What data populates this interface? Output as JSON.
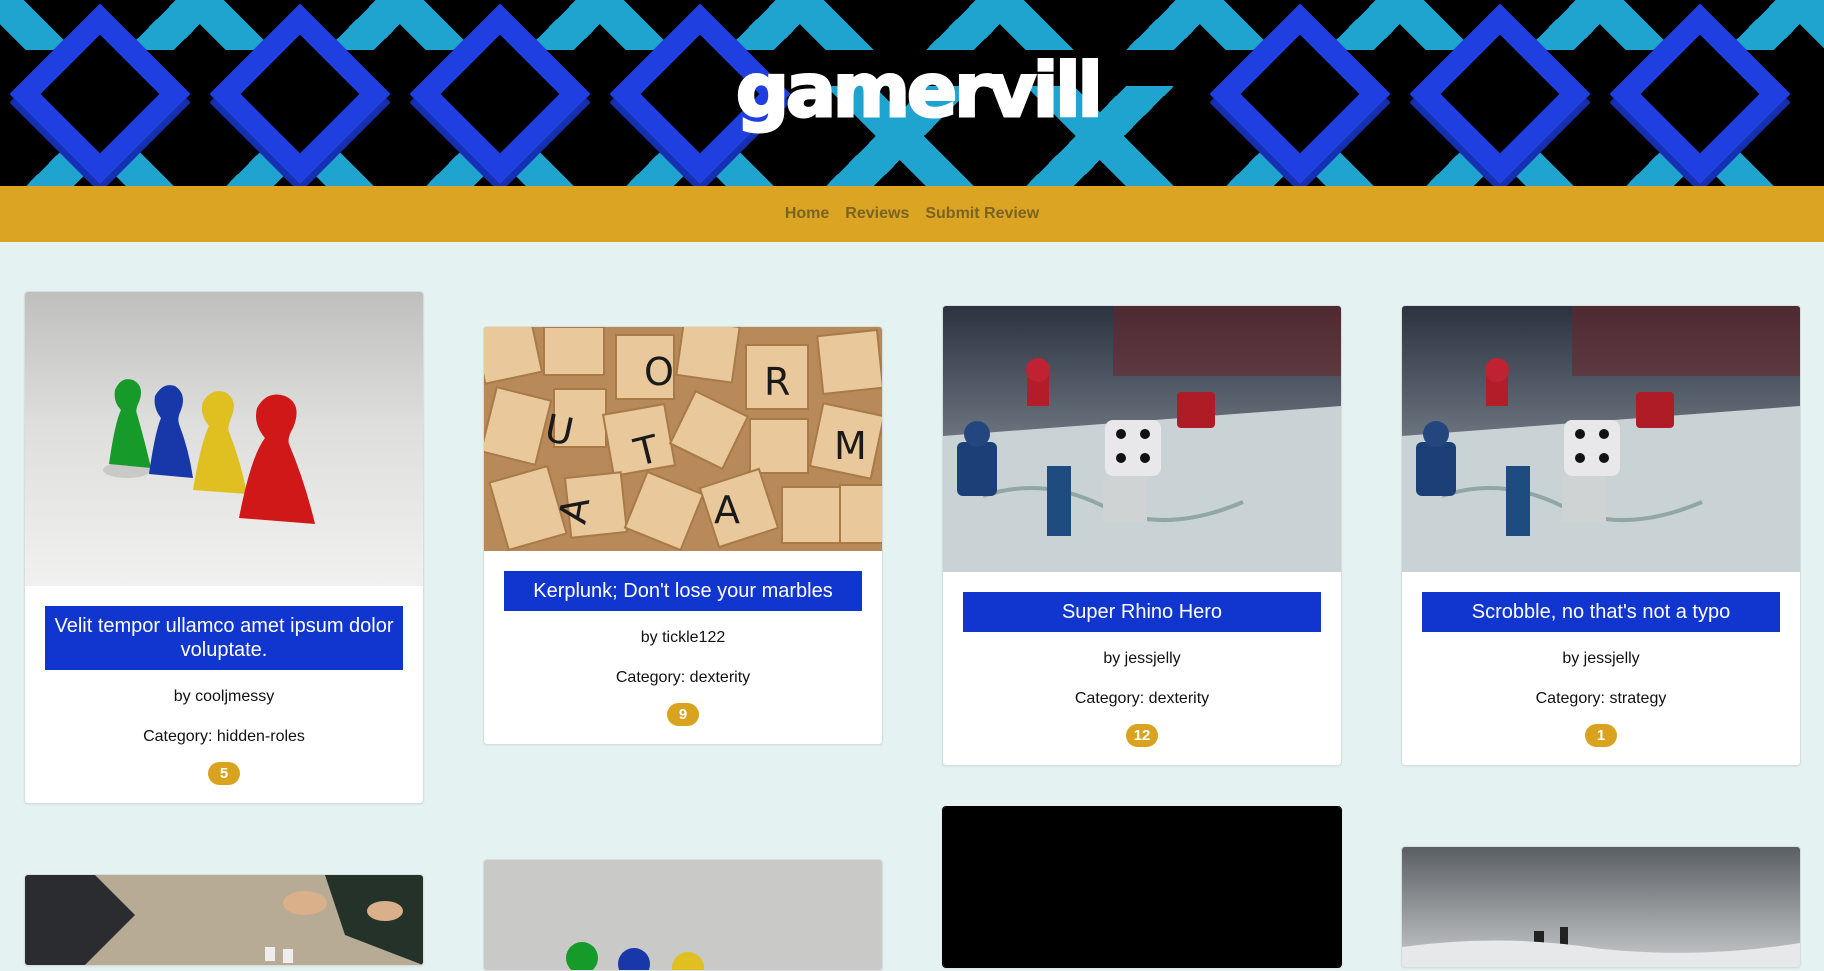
{
  "site": {
    "logo_text": "gamerville"
  },
  "nav": {
    "items": [
      "Home",
      "Reviews",
      "Submit Review"
    ]
  },
  "reviews": [
    {
      "title": "Velit tempor ullamco amet ipsum dolor voluptate.",
      "author": "by cooljmessy",
      "category": "Category: hidden-roles",
      "votes": "5",
      "image": "pawns"
    },
    {
      "title": "Kerplunk; Don't lose your marbles",
      "author": "by tickle122",
      "category": "Category: dexterity",
      "votes": "9",
      "image": "letter-tiles"
    },
    {
      "title": "Super Rhino Hero",
      "author": "by jessjelly",
      "category": "Category: dexterity",
      "votes": "12",
      "image": "board-dice"
    },
    {
      "title": "Scrobble, no that's not a typo",
      "author": "by jessjelly",
      "category": "Category: strategy",
      "votes": "1",
      "image": "board-dice"
    }
  ],
  "colors": {
    "nav_bg": "#dba523",
    "title_bg": "#1136cf",
    "badge_bg": "#d9a21f",
    "page_bg": "#e4f3f2"
  }
}
